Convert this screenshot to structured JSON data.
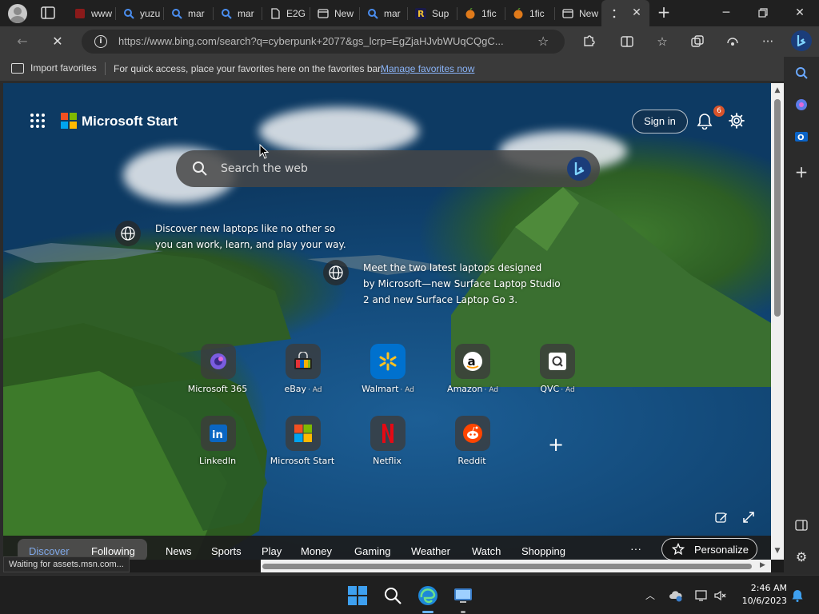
{
  "tabs": [
    {
      "label": "www",
      "favicon": "red-square-icon"
    },
    {
      "label": "yuzu",
      "favicon": "search-icon"
    },
    {
      "label": "mar",
      "favicon": "search-icon"
    },
    {
      "label": "mar",
      "favicon": "search-icon"
    },
    {
      "label": "E2G",
      "favicon": "page-icon"
    },
    {
      "label": "New",
      "favicon": "window-icon"
    },
    {
      "label": "mar",
      "favicon": "search-icon"
    },
    {
      "label": "Sup",
      "favicon": "r-logo-icon"
    },
    {
      "label": "1fic",
      "favicon": "orange-icon"
    },
    {
      "label": "1fic",
      "favicon": "orange-icon"
    },
    {
      "label": "New",
      "favicon": "window-icon"
    }
  ],
  "toolbar": {
    "url": "https://www.bing.com/search?q=cyberpunk+2077&gs_lcrp=EgZjaHJvbWUqCQgC..."
  },
  "favorites_bar": {
    "import_label": "Import favorites",
    "hint": "For quick access, place your favorites here on the favorites bar.",
    "manage_link": "Manage favorites now"
  },
  "header": {
    "brand": "Microsoft Start",
    "sign_in": "Sign in",
    "notification_count": "6"
  },
  "search": {
    "placeholder": "Search the web"
  },
  "promos": [
    {
      "text_line1": "Discover new laptops like no other so",
      "text_line2": "you can work, learn, and play your way."
    },
    {
      "text_line1": "Meet the two latest laptops designed",
      "text_line2": "by Microsoft—new Surface Laptop Studio",
      "text_line3": "2 and new Surface Laptop Go 3."
    }
  ],
  "quick_links": [
    {
      "label": "Microsoft 365",
      "ad": ""
    },
    {
      "label": "eBay",
      "ad": "· Ad"
    },
    {
      "label": "Walmart",
      "ad": "· Ad"
    },
    {
      "label": "Amazon",
      "ad": "· Ad"
    },
    {
      "label": "QVC",
      "ad": "· Ad"
    },
    {
      "label": "LinkedIn",
      "ad": ""
    },
    {
      "label": "Microsoft Start",
      "ad": ""
    },
    {
      "label": "Netflix",
      "ad": ""
    },
    {
      "label": "Reddit",
      "ad": ""
    }
  ],
  "feed_tabs": [
    "Discover",
    "Following",
    "News",
    "Sports",
    "Play",
    "Money",
    "Gaming",
    "Weather",
    "Watch",
    "Shopping"
  ],
  "feed": {
    "more": "···",
    "personalize": "Personalize"
  },
  "status": {
    "text": "Waiting for assets.msn.com..."
  },
  "clock": {
    "time": "2:46 AM",
    "date": "10/6/2023"
  },
  "colors": {
    "accent": "#7fa8e8",
    "badge": "#d9542b",
    "link": "#8ab4f8"
  }
}
